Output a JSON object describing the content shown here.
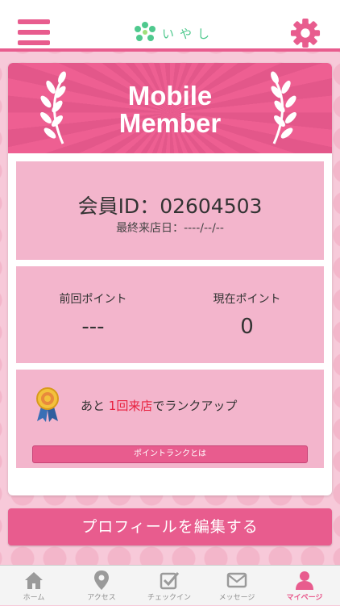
{
  "app": {
    "logo_text": "いやし",
    "accent_color": "#e85c8e",
    "logo_color": "#4fc98e"
  },
  "header": {
    "menu_icon": "hamburger-menu-icon",
    "settings_icon": "gear-icon"
  },
  "banner": {
    "title_line1": "Mobile",
    "title_line2": "Member"
  },
  "member": {
    "id_label": "会員ID：",
    "id_value": "02604503",
    "last_visit_label": "最終来店日：",
    "last_visit_value": "----/--/--"
  },
  "points": {
    "previous_label": "前回ポイント",
    "previous_value": "---",
    "current_label": "現在ポイント",
    "current_value": "0"
  },
  "rank": {
    "prefix": "あと ",
    "highlight": "1回来店",
    "suffix": "でランクアップ",
    "highlight_color": "#e8213f",
    "button_label": "ポイントランクとは"
  },
  "actions": {
    "edit_profile_label": "プロフィールを編集する"
  },
  "tabs": [
    {
      "label": "ホーム",
      "icon": "home-icon",
      "active": false
    },
    {
      "label": "アクセス",
      "icon": "location-pin-icon",
      "active": false
    },
    {
      "label": "チェックイン",
      "icon": "checkin-icon",
      "active": false
    },
    {
      "label": "メッセージ",
      "icon": "mail-icon",
      "active": false
    },
    {
      "label": "マイページ",
      "icon": "person-icon",
      "active": true
    }
  ]
}
